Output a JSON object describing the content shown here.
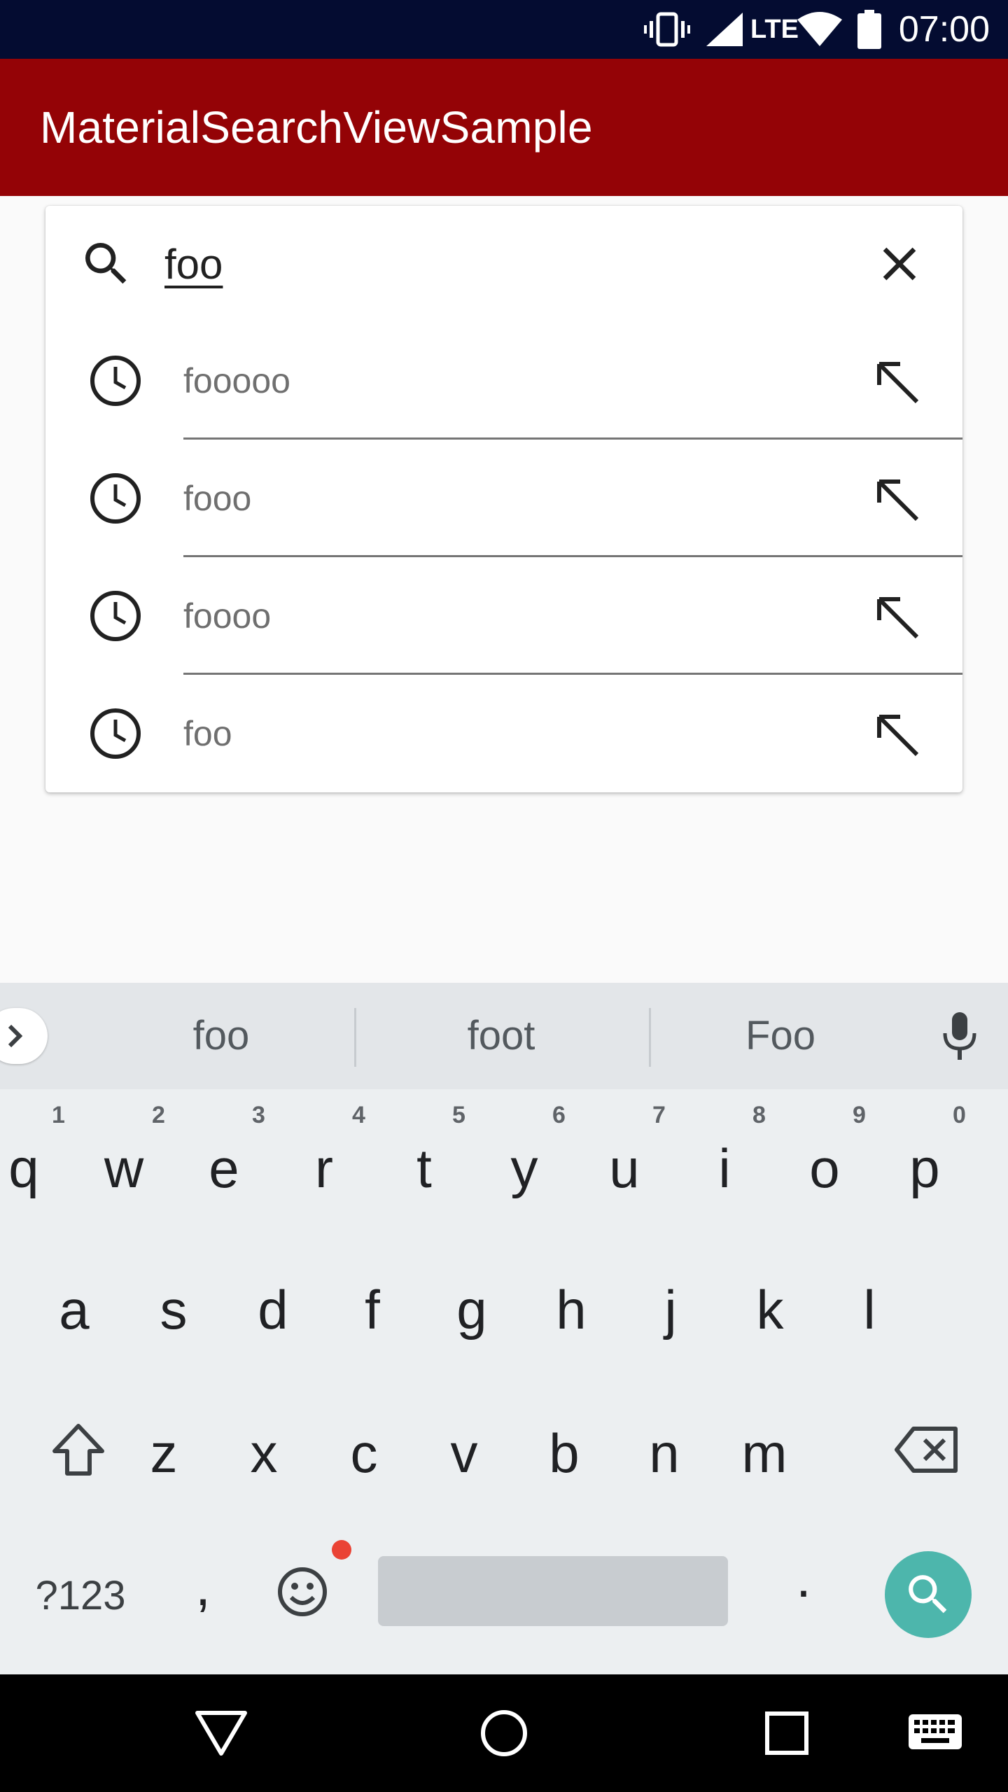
{
  "status_bar": {
    "time": "07:00",
    "network": "LTE",
    "icons": [
      "vibrate-icon",
      "signal-icon",
      "wifi-icon",
      "battery-icon"
    ]
  },
  "app_bar": {
    "title": "MaterialSearchViewSample",
    "color": "#940306"
  },
  "search": {
    "query": "foo",
    "suggestions": [
      {
        "text": "fooooo"
      },
      {
        "text": "fooo"
      },
      {
        "text": "foooo"
      },
      {
        "text": "foo"
      }
    ]
  },
  "keyboard": {
    "word_suggestions": [
      "foo",
      "foot",
      "Foo"
    ],
    "rows": [
      [
        {
          "label": "q",
          "hint": "1"
        },
        {
          "label": "w",
          "hint": "2"
        },
        {
          "label": "e",
          "hint": "3"
        },
        {
          "label": "r",
          "hint": "4"
        },
        {
          "label": "t",
          "hint": "5"
        },
        {
          "label": "y",
          "hint": "6"
        },
        {
          "label": "u",
          "hint": "7"
        },
        {
          "label": "i",
          "hint": "8"
        },
        {
          "label": "o",
          "hint": "9"
        },
        {
          "label": "p",
          "hint": "0"
        }
      ],
      [
        {
          "label": "a"
        },
        {
          "label": "s"
        },
        {
          "label": "d"
        },
        {
          "label": "f"
        },
        {
          "label": "g"
        },
        {
          "label": "h"
        },
        {
          "label": "j"
        },
        {
          "label": "k"
        },
        {
          "label": "l"
        }
      ],
      [
        {
          "label": "z"
        },
        {
          "label": "x"
        },
        {
          "label": "c"
        },
        {
          "label": "v"
        },
        {
          "label": "b"
        },
        {
          "label": "n"
        },
        {
          "label": "m"
        }
      ]
    ],
    "symbols_label": "?123",
    "comma": ",",
    "period": ".",
    "accent": "#4db6ac"
  },
  "nav_bar": {
    "icons": [
      "back-icon",
      "home-icon",
      "recents-icon",
      "keyboard-switch-icon"
    ]
  }
}
